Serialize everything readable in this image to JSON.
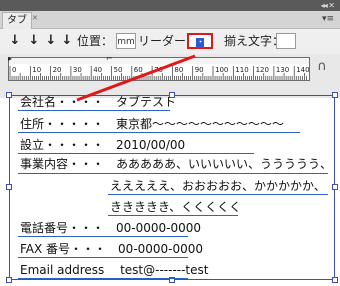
{
  "panel": {
    "collapse_glyph": "◂◂ ✕",
    "tab_label": "タブ",
    "tab_close": "✕",
    "menu_glyph": "▾≡"
  },
  "toolbar": {
    "tab_buttons": [
      "↓",
      "↓",
      "↓",
      "↓"
    ],
    "position_label": "位置：",
    "position_unit": "mm",
    "leader_label": "リーダー：",
    "leader_value": "・",
    "align_label": "揃え文字：",
    "align_value": ""
  },
  "ruler": {
    "labels": [
      "0",
      "10",
      "20",
      "30",
      "40",
      "50",
      "60",
      "70",
      "80",
      "90",
      "100",
      "110",
      "120",
      "130",
      "140"
    ]
  },
  "content": {
    "lines": [
      "会社名・・・・　タブテスト",
      "住所・・・・・　東京都〜〜〜〜〜〜〜〜〜〜〜",
      "設立・・・・・　2010/00/00",
      "事業内容・・・　あああああ、いいいいい、ううううう、",
      "えええええ、おおおおお、かかかかか、",
      "ききききき、くくくくく",
      "電話番号・・・　00-0000-0000",
      "FAX 番号・・・　00-0000-0000",
      "Email address　 test@-------test"
    ]
  },
  "colors": {
    "frame": "#3b4fbf",
    "highlight": "#e01818",
    "underline": "#2f62c8"
  }
}
